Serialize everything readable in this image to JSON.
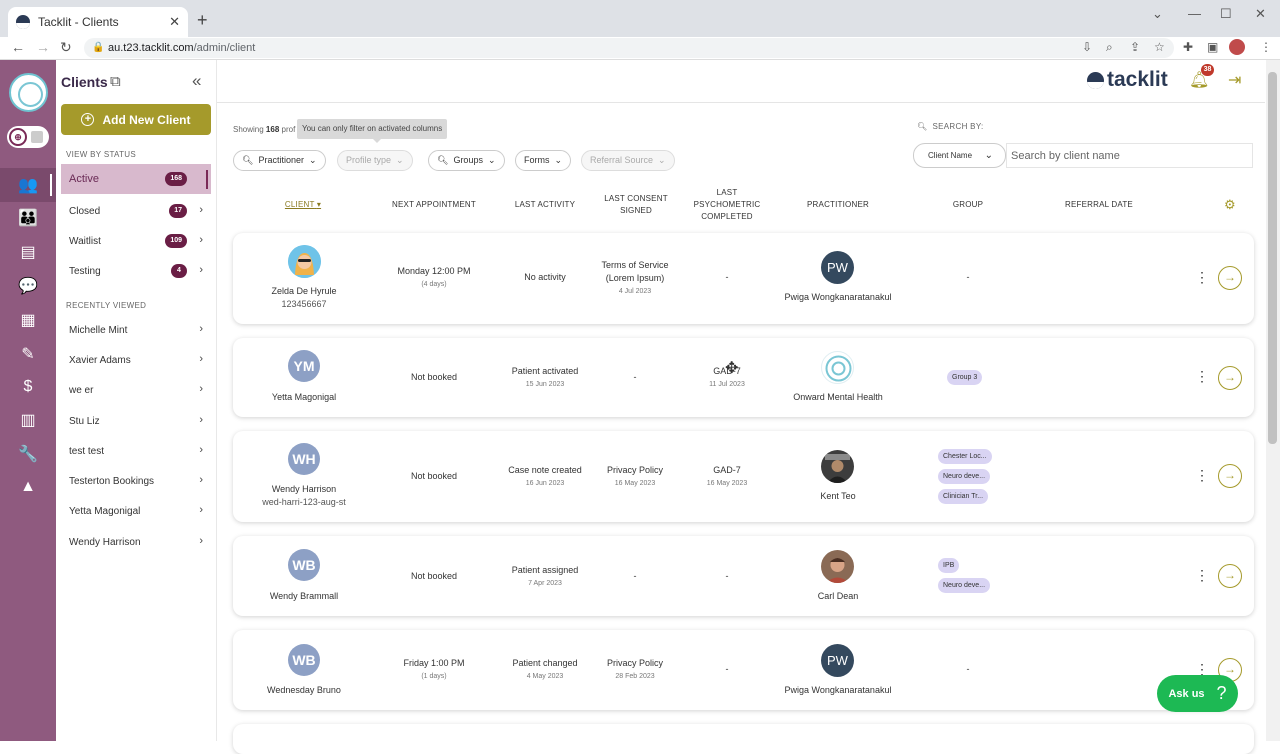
{
  "browser": {
    "tab_title": "Tacklit - Clients",
    "url_host": "au.t23.tacklit.com",
    "url_path": "/admin/client"
  },
  "sidebar": {
    "title": "Clients",
    "add_button": "Add New Client",
    "status_heading": "VIEW BY STATUS",
    "statuses": [
      {
        "label": "Active",
        "count": "168"
      },
      {
        "label": "Closed",
        "count": "17"
      },
      {
        "label": "Waitlist",
        "count": "109"
      },
      {
        "label": "Testing",
        "count": "4"
      }
    ],
    "recent_heading": "RECENTLY VIEWED",
    "recent": [
      "Michelle Mint",
      "Xavier Adams",
      "we er",
      "Stu Liz",
      "test test",
      "Testerton Bookings",
      "Yetta Magonigal",
      "Wendy Harrison"
    ]
  },
  "header": {
    "brand": "tacklit",
    "notifications": "38"
  },
  "toolbar": {
    "showing_prefix": "Showing",
    "showing_count": "168",
    "showing_suffix": "prof",
    "tooltip": "You can only filter on activated columns",
    "filters": [
      "Practitioner",
      "Profile type",
      "Groups",
      "Forms",
      "Referral Source"
    ],
    "search_by_label": "SEARCH BY:",
    "search_by_value": "Client Name",
    "search_placeholder": "Search by client name"
  },
  "columns": {
    "client": "CLIENT",
    "next": "NEXT APPOINTMENT",
    "activity": "LAST ACTIVITY",
    "consent": "LAST CONSENT SIGNED",
    "psych": "LAST PSYCHOMETRIC COMPLETED",
    "practitioner": "PRACTITIONER",
    "group": "GROUP",
    "referral": "REFERRAL DATE"
  },
  "rows": [
    {
      "name": "Zelda De Hyrule",
      "id": "123456667",
      "initials": "",
      "next": "Monday 12:00 PM",
      "next_sub": "(4 days)",
      "activity": "No activity",
      "activity_sub": "",
      "consent": "Terms of Service (Lorem Ipsum)",
      "consent_sub": "4 Jul 2023",
      "psych": "-",
      "psych_sub": "",
      "practitioner": "Pwiga Wongkanaratanakul",
      "prac_initials": "PW",
      "groups": [],
      "group_dash": "-"
    },
    {
      "name": "Yetta Magonigal",
      "id": "",
      "initials": "YM",
      "next": "Not booked",
      "next_sub": "",
      "activity": "Patient activated",
      "activity_sub": "15 Jun 2023",
      "consent": "-",
      "consent_sub": "",
      "psych": "GAD-7",
      "psych_sub": "11 Jul 2023",
      "practitioner": "Onward Mental Health",
      "prac_initials": "",
      "groups": [
        "Group 3"
      ],
      "group_dash": ""
    },
    {
      "name": "Wendy Harrison",
      "id": "wed-harri-123-aug-st",
      "initials": "WH",
      "next": "Not booked",
      "next_sub": "",
      "activity": "Case note created",
      "activity_sub": "16 Jun 2023",
      "consent": "Privacy Policy",
      "consent_sub": "16 May 2023",
      "psych": "GAD-7",
      "psych_sub": "16 May 2023",
      "practitioner": "Kent Teo",
      "prac_initials": "",
      "groups": [
        "Chester Loc...",
        "Neuro deve...",
        "Clinician Tr..."
      ],
      "group_dash": ""
    },
    {
      "name": "Wendy Brammall",
      "id": "",
      "initials": "WB",
      "next": "Not booked",
      "next_sub": "",
      "activity": "Patient assigned",
      "activity_sub": "7 Apr 2023",
      "consent": "-",
      "consent_sub": "",
      "psych": "-",
      "psych_sub": "",
      "practitioner": "Carl Dean",
      "prac_initials": "",
      "groups": [
        "IPB",
        "Neuro deve..."
      ],
      "group_dash": ""
    },
    {
      "name": "Wednesday Bruno",
      "id": "",
      "initials": "WB",
      "next": "Friday 1:00 PM",
      "next_sub": "(1 days)",
      "activity": "Patient changed",
      "activity_sub": "4 May 2023",
      "consent": "Privacy Policy",
      "consent_sub": "28 Feb 2023",
      "psych": "-",
      "psych_sub": "",
      "practitioner": "Pwiga Wongkanaratanakul",
      "prac_initials": "PW",
      "groups": [],
      "group_dash": "-"
    }
  ],
  "help": {
    "label": "Ask us",
    "icon": "?"
  },
  "colors": {
    "brand": "#2b3a55",
    "accent": "#a59a2b",
    "sidebar_strip": "#8f5a7f",
    "badge": "#6a1e45",
    "help": "#1db954"
  }
}
